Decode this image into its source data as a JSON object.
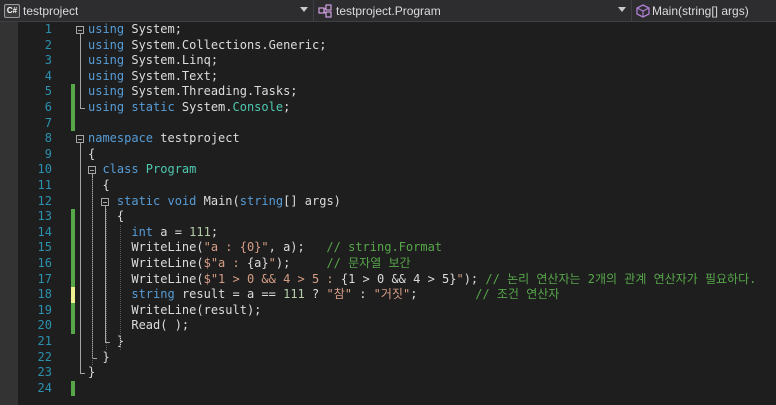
{
  "navbar": {
    "project": "testproject",
    "project_icon": "C#",
    "type": "testproject.Program",
    "member": "Main(string[] args)"
  },
  "colors": {
    "keyword": "#569cd6",
    "type": "#4ec9b0",
    "string": "#d69d85",
    "comment": "#57a64a",
    "number": "#b5cea8",
    "text": "#dcdcdc",
    "line_number": "#2b91af",
    "saved_change": "#57a64a",
    "unsaved_change": "#efef91"
  },
  "lines": [
    {
      "n": "1",
      "tokens": [
        [
          "kw",
          "using"
        ],
        [
          "",
          "System;"
        ]
      ]
    },
    {
      "n": "2",
      "tokens": [
        [
          "kw",
          "using"
        ],
        [
          "",
          "System.Collections.Generic;"
        ]
      ]
    },
    {
      "n": "3",
      "tokens": [
        [
          "kw",
          "using"
        ],
        [
          "",
          "System.Linq;"
        ]
      ]
    },
    {
      "n": "4",
      "tokens": [
        [
          "kw",
          "using"
        ],
        [
          "",
          "System.Text;"
        ]
      ]
    },
    {
      "n": "5",
      "tokens": [
        [
          "kw",
          "using"
        ],
        [
          "",
          "System.Threading.Tasks;"
        ]
      ]
    },
    {
      "n": "6",
      "tokens": [
        [
          "kw",
          "using"
        ],
        [
          "kw",
          "static"
        ],
        [
          "",
          "System."
        ],
        [
          "ty",
          "Console"
        ],
        [
          "",
          ";"
        ]
      ]
    },
    {
      "n": "7",
      "tokens": []
    },
    {
      "n": "8",
      "tokens": [
        [
          "kw",
          "namespace"
        ],
        [
          "",
          "testproject"
        ]
      ]
    },
    {
      "n": "9",
      "tokens": [
        [
          "",
          "{"
        ]
      ]
    },
    {
      "n": "10",
      "tokens": [
        [
          "",
          "  "
        ],
        [
          "kw",
          "class"
        ],
        [
          "ty",
          "Program"
        ]
      ]
    },
    {
      "n": "11",
      "tokens": [
        [
          "",
          "  {"
        ]
      ]
    },
    {
      "n": "12",
      "tokens": [
        [
          "",
          "    "
        ],
        [
          "kw",
          "static"
        ],
        [
          "kw",
          "void"
        ],
        [
          "",
          "Main("
        ],
        [
          "kw",
          "string"
        ],
        [
          "",
          "[] args)"
        ]
      ]
    },
    {
      "n": "13",
      "tokens": [
        [
          "",
          "    {"
        ]
      ]
    },
    {
      "n": "14",
      "tokens": [
        [
          "",
          "      "
        ],
        [
          "kw",
          "int"
        ],
        [
          "",
          "a = "
        ],
        [
          "nm",
          "111"
        ],
        [
          "",
          ";"
        ]
      ]
    },
    {
      "n": "15",
      "tokens": [
        [
          "",
          "      WriteLine("
        ],
        [
          "st",
          "\"a : {0}\""
        ],
        [
          "",
          ", a);   "
        ],
        [
          "cm",
          "// string.Format"
        ]
      ]
    },
    {
      "n": "16",
      "tokens": [
        [
          "",
          "      WriteLine("
        ],
        [
          "st",
          "$\"a : "
        ],
        [
          "",
          "{a}"
        ],
        [
          "st",
          "\""
        ],
        [
          "",
          ");     "
        ],
        [
          "cm",
          "// 문자열 보간"
        ]
      ]
    },
    {
      "n": "17",
      "tokens": [
        [
          "",
          "      WriteLine("
        ],
        [
          "st",
          "$\"1 > 0 && 4 > 5 : "
        ],
        [
          "",
          "{1 > 0 && 4 > 5}"
        ],
        [
          "st",
          "\""
        ],
        [
          "",
          "); "
        ],
        [
          "cm",
          "// 논리 연산자는 2개의 관계 연산자가 필요하다."
        ]
      ]
    },
    {
      "n": "18",
      "tokens": [
        [
          "",
          "      "
        ],
        [
          "kw",
          "string"
        ],
        [
          "",
          "result = a == "
        ],
        [
          "nm",
          "111"
        ],
        [
          "",
          " ? "
        ],
        [
          "st",
          "\"참\""
        ],
        [
          "",
          " : "
        ],
        [
          "st",
          "\"거짓\""
        ],
        [
          "",
          ";        "
        ],
        [
          "cm",
          "// 조건 연산자"
        ]
      ]
    },
    {
      "n": "19",
      "tokens": [
        [
          "",
          "      WriteLine(result);"
        ]
      ]
    },
    {
      "n": "20",
      "tokens": [
        [
          "",
          "      Read( );"
        ]
      ]
    },
    {
      "n": "21",
      "tokens": [
        [
          "",
          "    }"
        ]
      ]
    },
    {
      "n": "22",
      "tokens": [
        [
          "",
          "  }"
        ]
      ]
    },
    {
      "n": "23",
      "tokens": [
        [
          "",
          "}"
        ]
      ]
    },
    {
      "n": "24",
      "tokens": []
    }
  ]
}
